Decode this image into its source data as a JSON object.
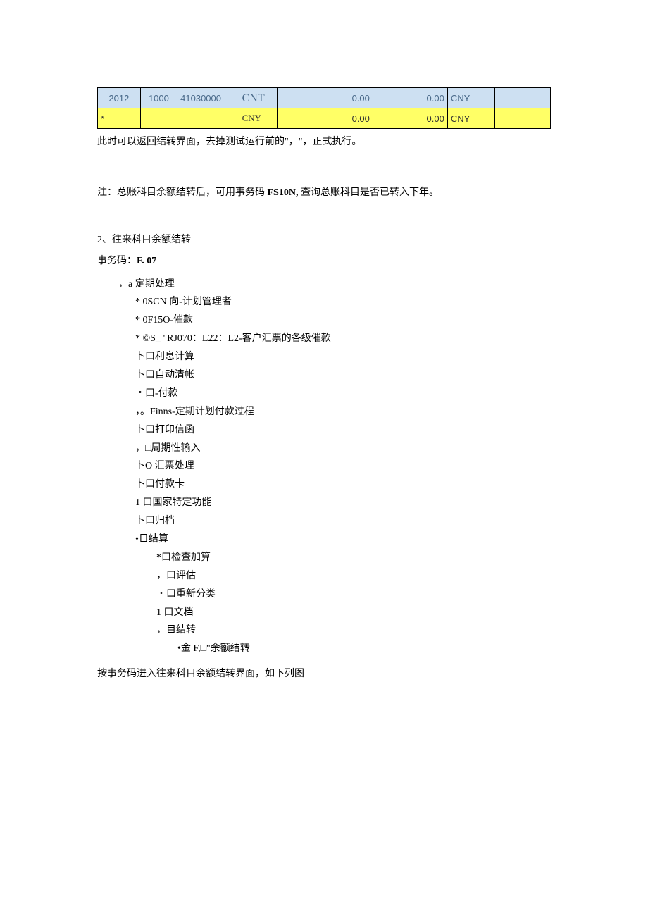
{
  "table": {
    "row1": {
      "c0": "2012",
      "c1": "1000",
      "c2": "41030000",
      "c3_top": "CNT",
      "c3_bot": "",
      "c4": "",
      "c5": "0.00",
      "c6": "0.00",
      "c7": "CNY",
      "c8": ""
    },
    "row2": {
      "c0": "*",
      "c1": "",
      "c2": "",
      "c3": "CNY",
      "c4": "",
      "c5": "0.00",
      "c6": "0.00",
      "c7": "CNY",
      "c8": ""
    }
  },
  "p1": "此时可以返回结转界面，去掉测试运行前的\"，\"，正式执行。",
  "note_prefix": "注：总账科目余额结转后，可用事务码 ",
  "note_code": "FS10N,",
  "note_suffix": " 查询总账科目是否已转入下年。",
  "sect2": "2、往来科目余额结转",
  "txcode_label": "事务码：",
  "txcode": "F. 07",
  "tree": {
    "n0": "，a 定期处理",
    "n1": "* 0SCN 向-计划管理者",
    "n2": "* 0F15O-催款",
    "n3": "* ©S_ \"RJ070：L22：L2-客户汇票的各级催款",
    "n4": "卜口利息计算",
    "n5": "卜口自动清帐",
    "n6": "・口-付款",
    "n7": "，。Finns-定期计划付款过程",
    "n8": "卜口打印信函",
    "n9": "，□周期性输入",
    "n10": "卜O 汇票处理",
    "n11": "卜口付款卡",
    "n12": "1 口国家特定功能",
    "n13": "卜口归档",
    "n14": "•日结算",
    "n15": "*口检查加算",
    "n16": "，口评估",
    "n17": "・口重新分类",
    "n18": "1 口文档",
    "n19": "，目结转",
    "n20": "•金 F,□\"余额结转"
  },
  "p_end": "按事务码进入往来科目余额结转界面，如下列图"
}
